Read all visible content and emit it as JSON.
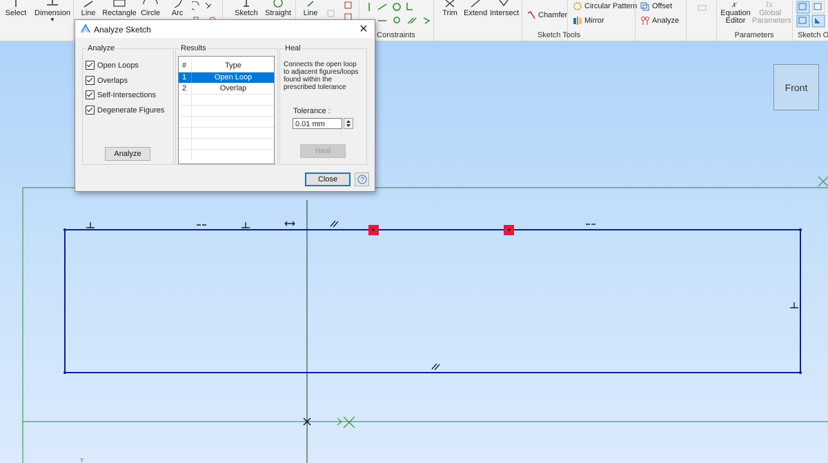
{
  "ribbon": {
    "buttons": [
      {
        "id": "select",
        "label": "Select",
        "icon": "select-icon"
      },
      {
        "id": "dimension",
        "label": "Dimension",
        "icon": "dimension-icon"
      },
      {
        "id": "line",
        "label": "Line",
        "icon": "line-icon"
      },
      {
        "id": "rectangle",
        "label": "Rectangle",
        "icon": "rectangle-icon"
      },
      {
        "id": "circle",
        "label": "Circle",
        "icon": "circle-icon"
      },
      {
        "id": "arc",
        "label": "Arc",
        "icon": "arc-icon"
      },
      {
        "id": "sketch",
        "label": "Sketch",
        "icon": "sketch-icon"
      },
      {
        "id": "straight",
        "label": "Straight",
        "icon": "straight-icon"
      },
      {
        "id": "line2",
        "label": "Line",
        "icon": "line-icon"
      },
      {
        "id": "trim",
        "label": "Trim",
        "icon": "trim-icon"
      },
      {
        "id": "extend",
        "label": "Extend",
        "icon": "extend-icon"
      },
      {
        "id": "intersect",
        "label": "Intersect",
        "icon": "intersect-icon"
      },
      {
        "id": "chamfer",
        "label": "Chamfer",
        "icon": "chamfer-icon"
      },
      {
        "id": "circular_pattern",
        "label": "Circular Pattern",
        "icon": "circular-pattern-icon"
      },
      {
        "id": "mirror",
        "label": "Mirror",
        "icon": "mirror-icon"
      },
      {
        "id": "offset",
        "label": "Offset",
        "icon": "offset-icon"
      },
      {
        "id": "analyze",
        "label": "Analyze",
        "icon": "analyze-icon"
      },
      {
        "id": "equation_editor",
        "label": "Equation Editor",
        "line1": "Equation",
        "line2": "Editor",
        "icon": "equation-editor-icon"
      },
      {
        "id": "global_parameters",
        "label": "Global Parameters",
        "line1": "Global",
        "line2": "Parameters",
        "icon": "global-parameters-icon"
      }
    ],
    "groups": [
      {
        "label": "Constraints"
      },
      {
        "label": "Sketch Tools"
      },
      {
        "label": "Parameters"
      },
      {
        "label": "Sketch Op"
      }
    ]
  },
  "viewport": {
    "view_cube_label": "Front"
  },
  "dialog": {
    "title": "Analyze Sketch",
    "close_glyph": "✕",
    "analyze_group": {
      "legend": "Analyze",
      "checks": [
        {
          "label": "Open Loops",
          "checked": true
        },
        {
          "label": "Overlaps",
          "checked": true
        },
        {
          "label": "Self-Intersections",
          "checked": true
        },
        {
          "label": "Degenerate Figures",
          "checked": true
        }
      ],
      "button": "Analyze"
    },
    "results_group": {
      "legend": "Results",
      "columns": [
        "#",
        "Type"
      ],
      "rows": [
        {
          "num": "1",
          "type": "Open Loop",
          "selected": true
        },
        {
          "num": "2",
          "type": "Overlap",
          "selected": false
        }
      ]
    },
    "heal_group": {
      "legend": "Heal",
      "description": "Connects the open loop to adjacent figures/loops found within the prescribed tolerance",
      "tolerance_label": "Tolerance :",
      "tolerance_value": "0.01 mm",
      "button": "Heal"
    },
    "close_button": "Close",
    "help_glyph": "?"
  },
  "colors": {
    "accent": "#0078d7",
    "sketch_line": "#0a1f9e",
    "error_marker": "#e21b3c",
    "axis_line": "#2f8a2f"
  }
}
